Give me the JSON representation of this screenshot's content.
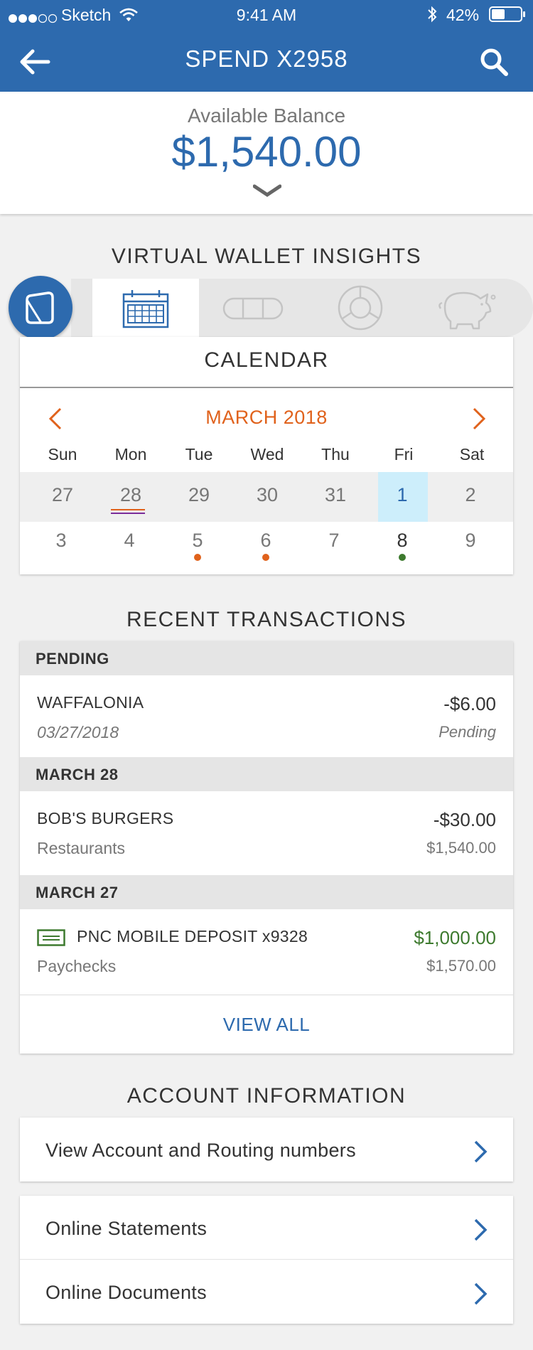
{
  "status_bar": {
    "carrier": "Sketch",
    "time": "9:41 AM",
    "battery": "42%"
  },
  "nav": {
    "title": "SPEND X2958"
  },
  "balance": {
    "label": "Available Balance",
    "amount": "$1,540.00"
  },
  "insights": {
    "title": "VIRTUAL WALLET INSIGHTS",
    "active_tab": "calendar",
    "tabs": [
      "wallet-icon",
      "calendar-icon",
      "bills-icon",
      "chart-icon",
      "piggy-bank-icon"
    ]
  },
  "calendar": {
    "title": "CALENDAR",
    "month": "MARCH 2018",
    "weekdays": [
      "Sun",
      "Mon",
      "Tue",
      "Wed",
      "Thu",
      "Fri",
      "Sat"
    ],
    "week1": [
      "27",
      "28",
      "29",
      "30",
      "31",
      "1",
      "2"
    ],
    "week2": [
      "3",
      "4",
      "5",
      "6",
      "7",
      "8",
      "9"
    ]
  },
  "transactions": {
    "title": "RECENT TRANSACTIONS",
    "groups": [
      {
        "header": "PENDING",
        "items": [
          {
            "name": "WAFFALONIA",
            "sub": "03/27/2018",
            "amount": "-$6.00",
            "balance": "Pending"
          }
        ]
      },
      {
        "header": "MARCH 28",
        "items": [
          {
            "name": "BOB'S BURGERS",
            "sub": "Restaurants",
            "amount": "-$30.00",
            "balance": "$1,540.00"
          }
        ]
      },
      {
        "header": "MARCH 27",
        "items": [
          {
            "name": "PNC MOBILE DEPOSIT x9328",
            "sub": "Paychecks",
            "amount": "$1,000.00",
            "balance": "$1,570.00"
          }
        ]
      }
    ],
    "view_all": "VIEW ALL"
  },
  "account_info": {
    "title": "ACCOUNT INFORMATION",
    "items": [
      "View Account and Routing numbers",
      "Online Statements",
      "Online Documents"
    ]
  },
  "colors": {
    "brand": "#2d6aae",
    "accent": "#e0621c",
    "positive": "#3d7a2e",
    "today": "#cdeefb"
  }
}
